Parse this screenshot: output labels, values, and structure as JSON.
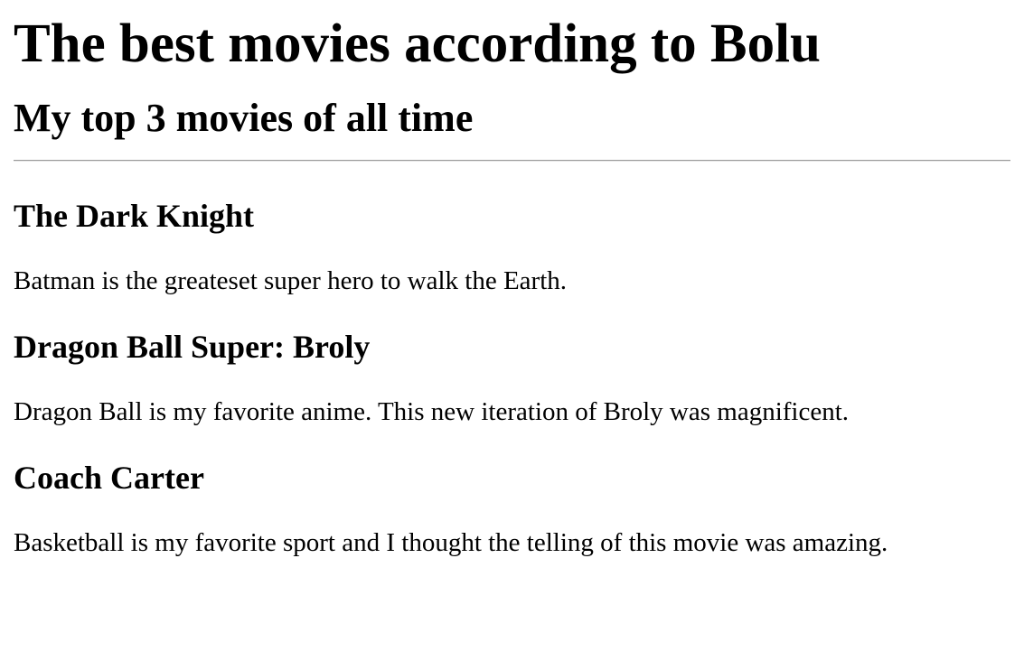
{
  "page": {
    "title": "The best movies according to Bolu",
    "subtitle": "My top 3 movies of all time"
  },
  "movies": [
    {
      "title": "The Dark Knight",
      "description": "Batman is the greateset super hero to walk the Earth."
    },
    {
      "title": "Dragon Ball Super: Broly",
      "description": "Dragon Ball is my favorite anime. This new iteration of Broly was magnificent."
    },
    {
      "title": "Coach Carter",
      "description": "Basketball is my favorite sport and I thought the telling of this movie was amazing."
    }
  ]
}
